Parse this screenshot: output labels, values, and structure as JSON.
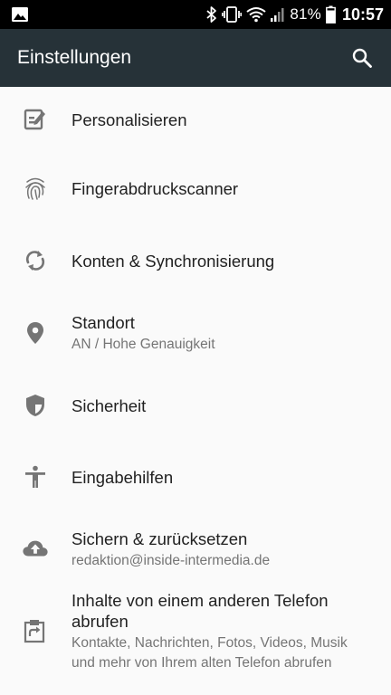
{
  "status_bar": {
    "battery": "81%",
    "time": "10:57",
    "icons": [
      "image-notification-icon",
      "bluetooth-icon",
      "vibrate-icon",
      "wifi-icon",
      "signal-icon",
      "battery-icon"
    ]
  },
  "toolbar": {
    "title": "Einstellungen",
    "search_icon": "search-icon"
  },
  "items": [
    {
      "title": "Personalisieren",
      "icon": "personalize-icon"
    },
    {
      "title": "Fingerabdruckscanner",
      "icon": "fingerprint-icon"
    },
    {
      "title": "Konten & Synchronisierung",
      "icon": "sync-icon"
    },
    {
      "title": "Standort",
      "summary": "AN / Hohe Genauigkeit",
      "icon": "location-icon"
    },
    {
      "title": "Sicherheit",
      "icon": "shield-icon"
    },
    {
      "title": "Eingabehilfen",
      "icon": "accessibility-icon"
    },
    {
      "title": "Sichern & zurücksetzen",
      "summary": "redaktion@inside-intermedia.de",
      "icon": "cloud-upload-icon"
    },
    {
      "title": "Inhalte von einem anderen Telefon abrufen",
      "summary": "Kontakte, Nachrichten, Fotos, Videos, Musik und mehr von Ihrem alten Telefon abrufen",
      "icon": "phone-transfer-icon"
    }
  ],
  "colors": {
    "toolbar_bg": "#263238",
    "status_bar_bg": "#000000",
    "icon_color": "#757575",
    "title_color": "#212121",
    "summary_color": "#757575",
    "background": "#fafafa"
  }
}
